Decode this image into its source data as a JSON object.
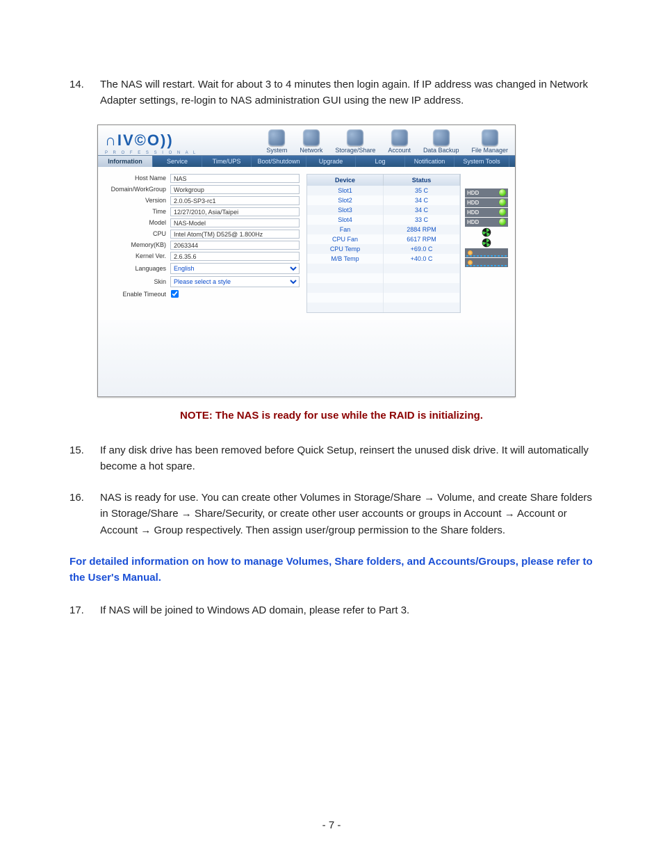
{
  "page_number": "- 7 -",
  "items": {
    "n14": "14.",
    "t14": "The NAS will restart. Wait for about 3 to 4 minutes then login again. If IP address was changed in Network Adapter settings, re-login to NAS administration GUI using the new IP address.",
    "n15": "15.",
    "t15": "If any disk drive has been removed before Quick Setup, reinsert the unused disk drive. It will automatically become a hot spare.",
    "n16": "16.",
    "t16": "NAS is ready for use. You can create other Volumes in Storage/Share → Volume, and create Share folders in Storage/Share → Share/Security, or create other user accounts or groups in Account → Account or Account → Group respectively. Then assign user/group permission to the Share folders.",
    "n17": "17.",
    "t17": "If NAS will be joined to Windows AD domain, please refer to Part 3."
  },
  "note": "NOTE: The NAS is ready for use while the RAID is initializing.",
  "manual_ref": "For detailed information on how to manage Volumes, Share folders, and Accounts/Groups, please refer to the User's Manual.",
  "shot": {
    "logo_main": "∩IV©O))",
    "logo_sub": "P R O F E S S I O N A L",
    "nav": [
      "System",
      "Network",
      "Storage/Share",
      "Account",
      "Data Backup",
      "File Manager"
    ],
    "tabs": [
      "Information",
      "Service",
      "Time/UPS",
      "Boot/Shutdown",
      "Upgrade",
      "Log",
      "Notification",
      "System Tools"
    ],
    "info_labels": [
      "Host Name",
      "Domain/WorkGroup",
      "Version",
      "Time",
      "Model",
      "CPU",
      "Memory(KB)",
      "Kernel Ver.",
      "Languages",
      "Skin",
      "Enable Timeout"
    ],
    "info_values": {
      "host": "NAS",
      "domain": "Workgroup",
      "version": "2.0.05-SP3-rc1",
      "time": "12/27/2010, Asia/Taipei",
      "model": "NAS-Model",
      "cpu": "Intel Atom(TM) D525@ 1.800Hz",
      "memory": "2063344",
      "kernel": "2.6.35.6",
      "language": "English",
      "skin": "Please select a style"
    },
    "dev_header": [
      "Device",
      "Status"
    ],
    "dev_rows": [
      [
        "Slot1",
        "35 C"
      ],
      [
        "Slot2",
        "34 C"
      ],
      [
        "Slot3",
        "34 C"
      ],
      [
        "Slot4",
        "33 C"
      ],
      [
        "Fan",
        "2884 RPM"
      ],
      [
        "CPU Fan",
        "6617 RPM"
      ],
      [
        "CPU Temp",
        "+69.0 C"
      ],
      [
        "M/B Temp",
        "+40.0 C"
      ]
    ],
    "hdd_label": "HDD"
  }
}
